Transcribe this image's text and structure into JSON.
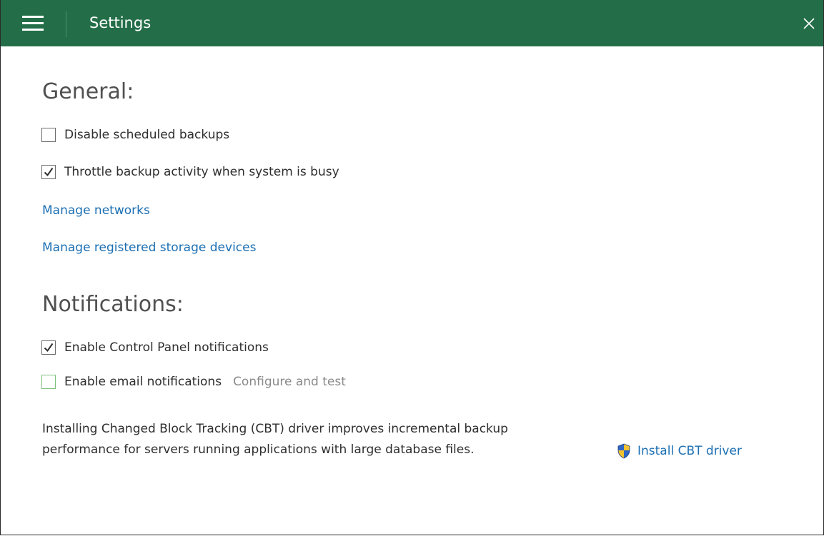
{
  "window": {
    "title": "Settings"
  },
  "general": {
    "heading": "General:",
    "disable_backups": {
      "label": "Disable scheduled backups",
      "checked": false
    },
    "throttle": {
      "label": "Throttle backup activity when system is busy",
      "checked": true
    },
    "manage_networks": "Manage networks",
    "manage_storage": "Manage registered storage devices"
  },
  "notifications": {
    "heading": "Notifications:",
    "control_panel": {
      "label": "Enable Control Panel notifications",
      "checked": true
    },
    "email": {
      "label": "Enable email notifications",
      "checked": false,
      "configure_label": "Configure and test"
    }
  },
  "cbt": {
    "description": "Installing Changed Block Tracking (CBT) driver improves incremental backup performance for servers running applications with large database files.",
    "install_label": "Install CBT driver",
    "install_icon": "uac-shield-icon"
  },
  "colors": {
    "titlebar": "#236e48",
    "link": "#1b6fb3",
    "email_checkbox_border": "#7ac17a"
  }
}
